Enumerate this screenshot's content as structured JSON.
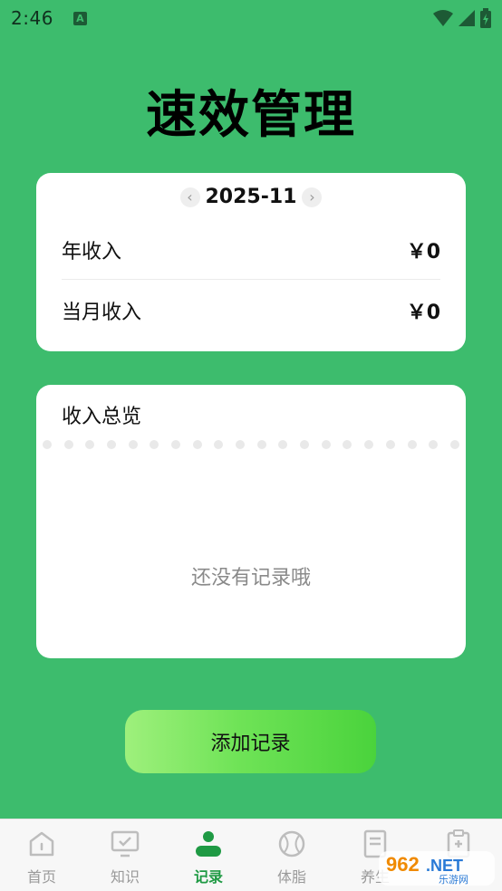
{
  "status_bar": {
    "time": "2:46",
    "notif_icon": "A"
  },
  "app": {
    "title": "速效管理"
  },
  "income_card": {
    "month": "2025-11",
    "rows": [
      {
        "label": "年收入",
        "value": "￥0"
      },
      {
        "label": "当月收入",
        "value": "￥0"
      }
    ]
  },
  "overview": {
    "title": "收入总览",
    "empty_text": "还没有记录哦"
  },
  "actions": {
    "add_label": "添加记录"
  },
  "tabbar": {
    "tabs": [
      {
        "label": "首页",
        "icon": "home-icon"
      },
      {
        "label": "知识",
        "icon": "board-icon"
      },
      {
        "label": "记录",
        "icon": "person-icon",
        "active": true
      },
      {
        "label": "体脂",
        "icon": "ball-icon"
      },
      {
        "label": "养生",
        "icon": "document-icon"
      },
      {
        "label": "",
        "icon": "clipboard-icon"
      }
    ]
  },
  "watermark": {
    "text": "962.NET",
    "sub": "乐游网"
  },
  "colors": {
    "background": "#3dbc6d",
    "accent": "#1f9a44",
    "card": "#ffffff"
  }
}
